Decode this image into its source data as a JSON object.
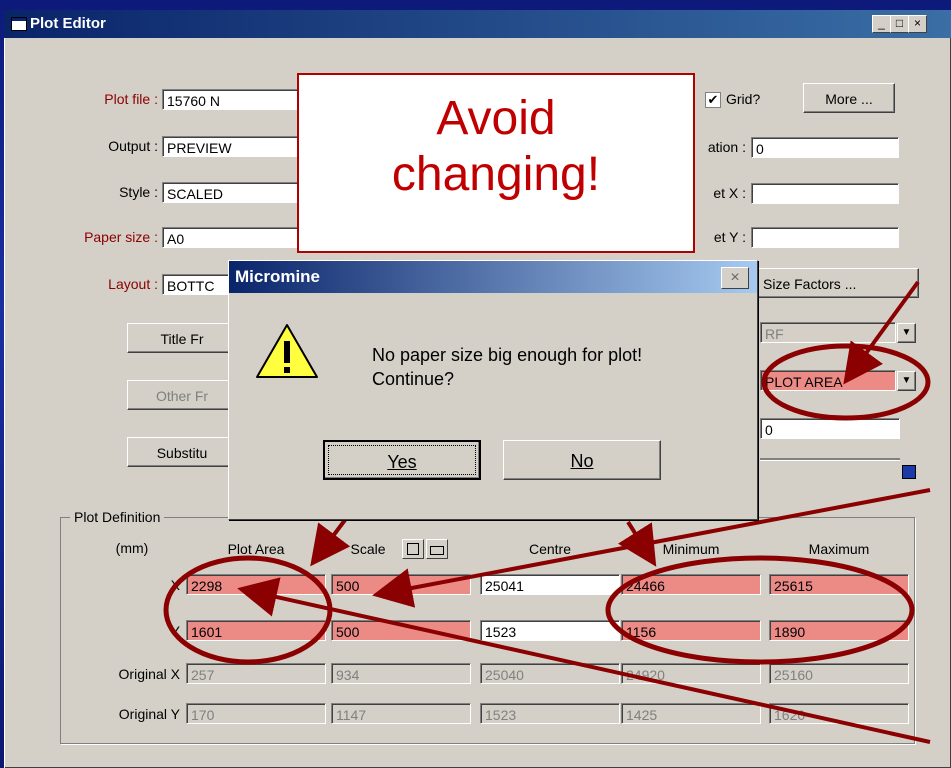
{
  "window": {
    "title": "Plot Editor",
    "minimize": "_",
    "maximize": "□",
    "close": "×"
  },
  "left": {
    "plot_file_label": "Plot file :",
    "plot_file_value": "15760 N",
    "output_label": "Output :",
    "output_value": "PREVIEW",
    "style_label": "Style :",
    "style_value": "SCALED",
    "paper_size_label": "Paper size :",
    "paper_size_value": "A0",
    "layout_label": "Layout :",
    "layout_value": "BOTTC"
  },
  "right": {
    "grid_check": "✔",
    "grid_label": "Grid?",
    "more_button": "More ...",
    "rotation_label": "ation :",
    "rotation_value": "0",
    "offset_x_label": "et X :",
    "offset_x_value": "",
    "offset_y_label": "et Y :",
    "offset_y_value": "",
    "size_factors_button": "Size Factors ...",
    "dropdown1_value": "RF",
    "dropdown2_value": "PLOT AREA",
    "field_value": "0"
  },
  "buttons": {
    "title_frame": "Title Fr",
    "other_frame": "Other Fr",
    "substitute": "Substitu"
  },
  "plot_definition": {
    "title": "Plot Definition",
    "units": "(mm)",
    "col_plot_area": "Plot Area",
    "col_scale": "Scale",
    "col_centre": "Centre",
    "col_minimum": "Minimum",
    "col_maximum": "Maximum",
    "rows": [
      {
        "label": "X",
        "plot_area": "2298",
        "scale": "500",
        "centre": "25041",
        "minimum": "24466",
        "maximum": "25615"
      },
      {
        "label": "Y",
        "plot_area": "1601",
        "scale": "500",
        "centre": "1523",
        "minimum": "1156",
        "maximum": "1890"
      },
      {
        "label": "Original X",
        "plot_area": "257",
        "scale": "934",
        "centre": "25040",
        "minimum": "24920",
        "maximum": "25160"
      },
      {
        "label": "Original Y",
        "plot_area": "170",
        "scale": "1147",
        "centre": "1523",
        "minimum": "1425",
        "maximum": "1620"
      }
    ]
  },
  "callout": {
    "line1": "Avoid",
    "line2": "changing!"
  },
  "dialog": {
    "title": "Micromine",
    "close": "×",
    "message_line1": "No paper size big enough for plot!",
    "message_line2": "Continue?",
    "yes_label": "Yes",
    "no_label": "No"
  },
  "colors": {
    "annotation": "#8b0000",
    "highlight": "#ff5050"
  }
}
